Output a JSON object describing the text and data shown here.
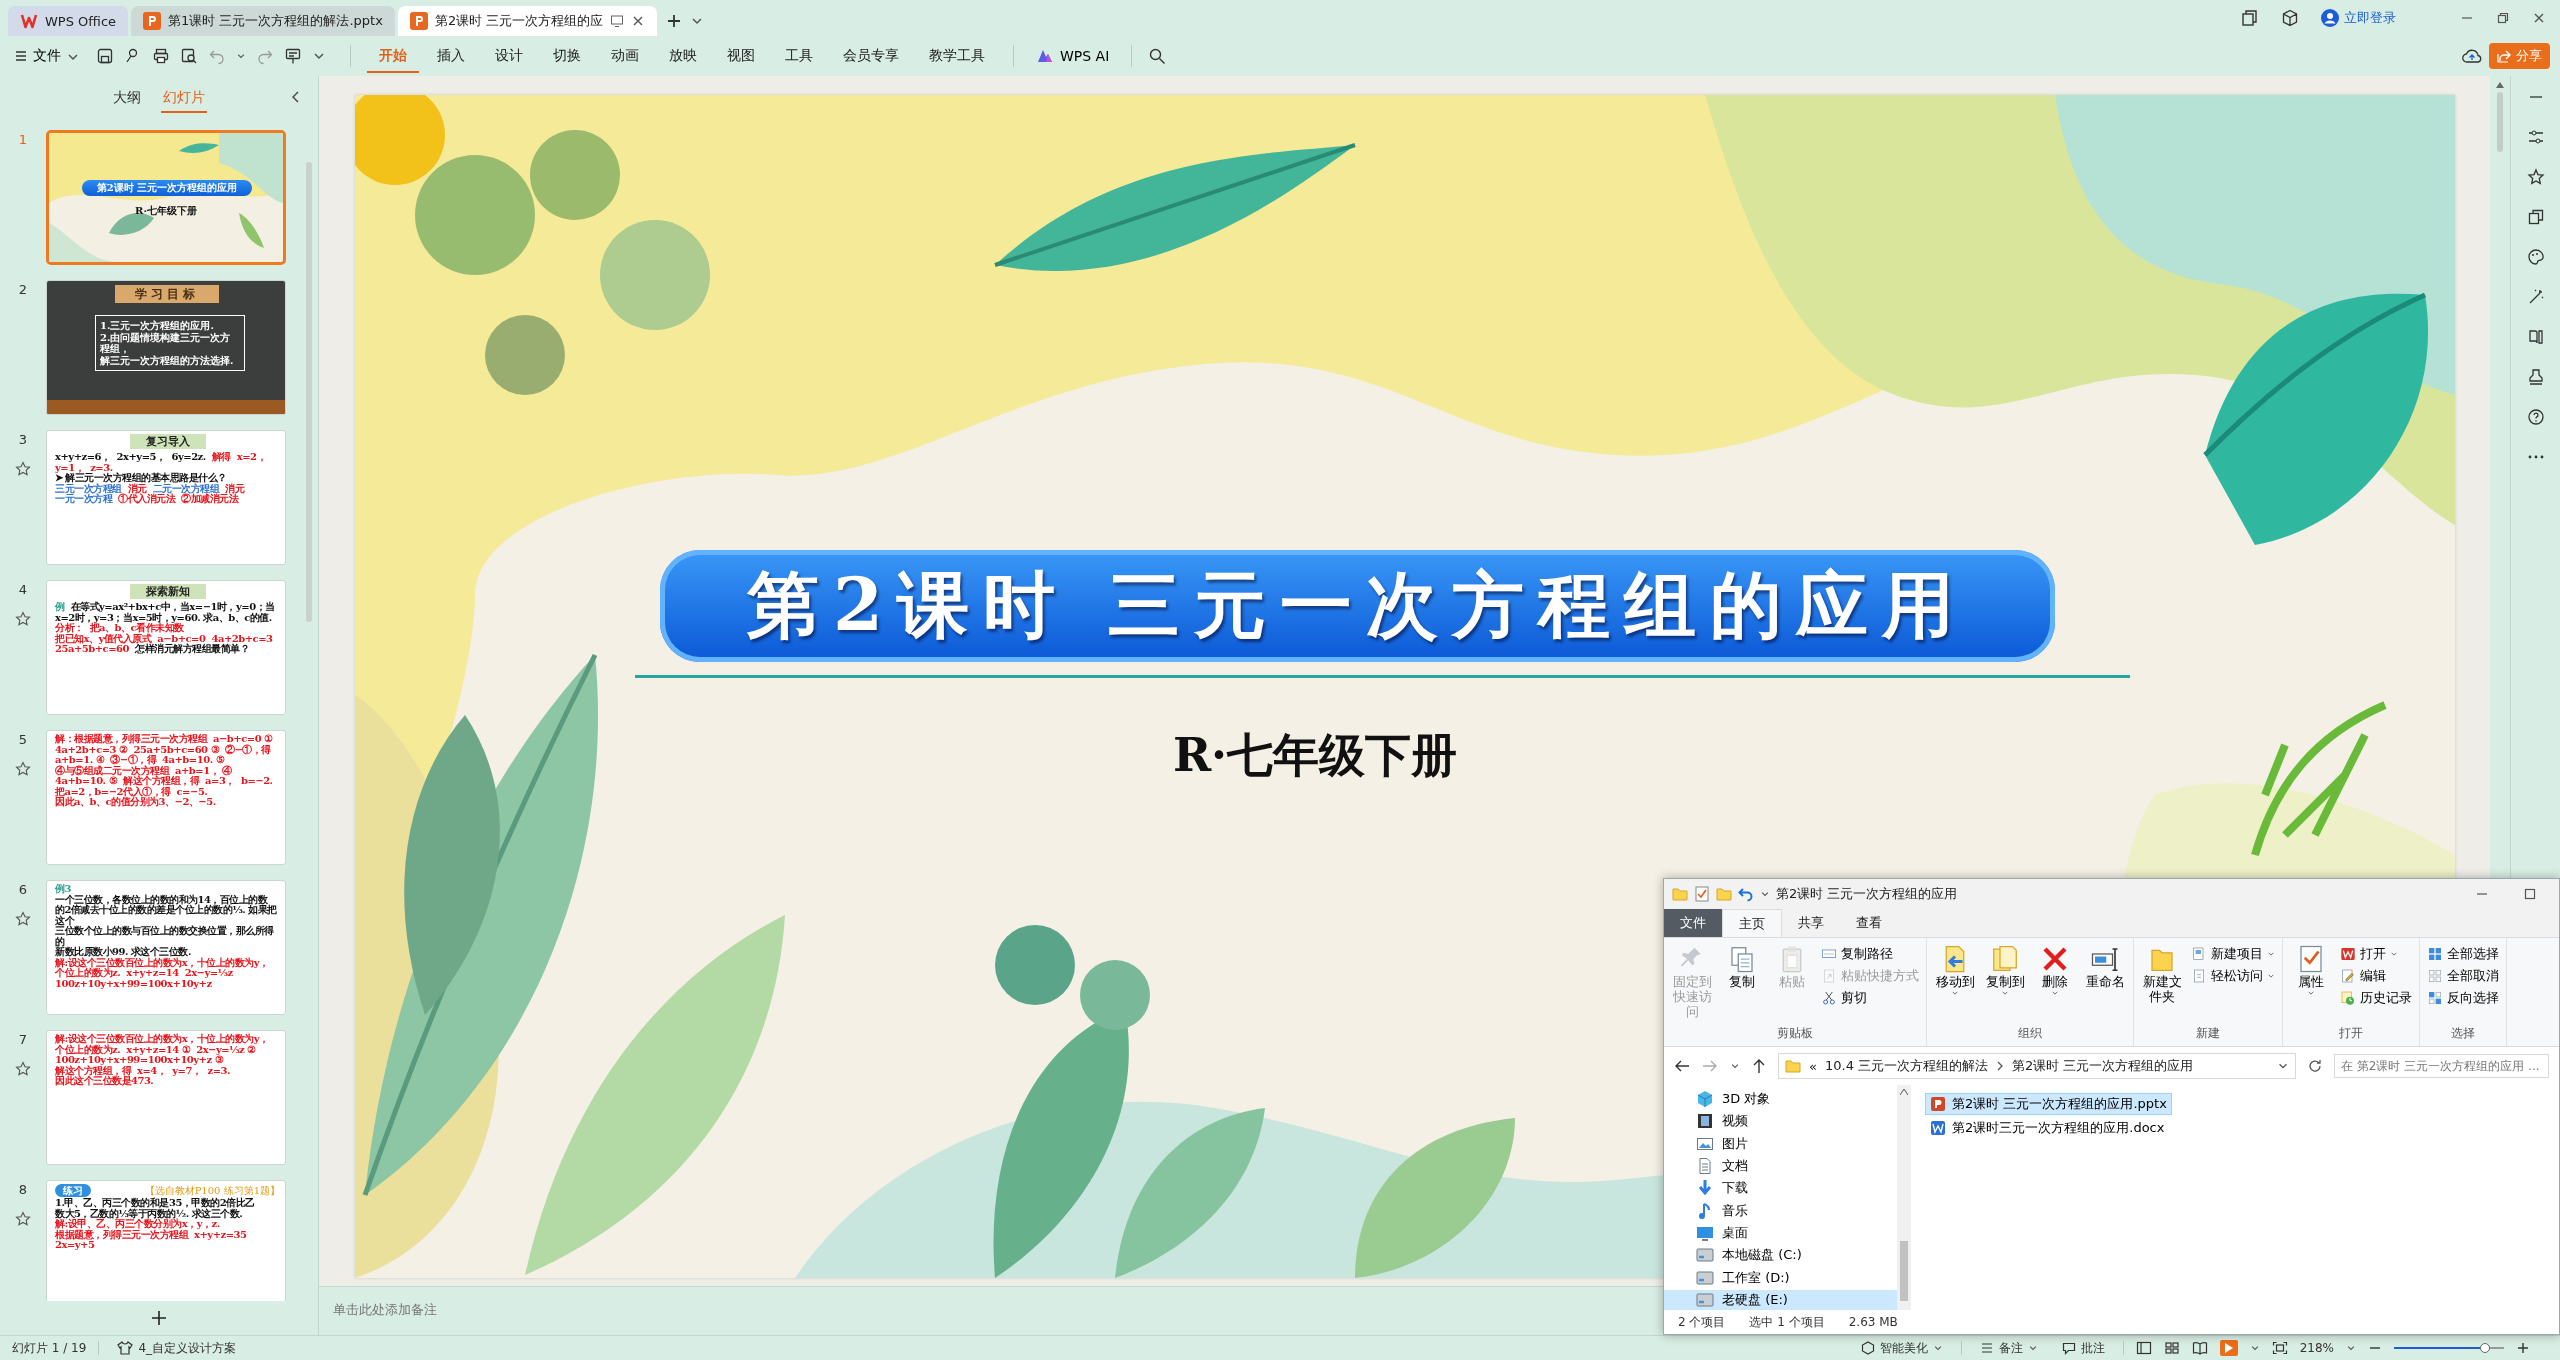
{
  "title_bar": {
    "tabs": [
      {
        "label": "WPS Office",
        "kind": "home",
        "selected": false
      },
      {
        "label": "第1课时 三元一次方程组的解法.pptx",
        "kind": "pptx",
        "selected": false
      },
      {
        "label": "第2课时 三元一次方程组的应",
        "kind": "pptx",
        "selected": true
      }
    ],
    "login": "立即登录"
  },
  "toolbar": {
    "file_menu": "文件",
    "tabs": [
      {
        "label": "开始",
        "selected": true
      },
      {
        "label": "插入",
        "selected": false
      },
      {
        "label": "设计",
        "selected": false
      },
      {
        "label": "切换",
        "selected": false
      },
      {
        "label": "动画",
        "selected": false
      },
      {
        "label": "放映",
        "selected": false
      },
      {
        "label": "视图",
        "selected": false
      },
      {
        "label": "工具",
        "selected": false
      },
      {
        "label": "会员专享",
        "selected": false
      },
      {
        "label": "教学工具",
        "selected": false
      }
    ],
    "ai": "WPS AI",
    "share": "分享"
  },
  "slide_panel": {
    "tabs": [
      {
        "label": "大纲",
        "selected": false
      },
      {
        "label": "幻灯片",
        "selected": true
      }
    ],
    "slides": [
      {
        "number": "1",
        "kind": "title",
        "selected": true,
        "star": false,
        "lines": [
          {
            "text": "第2课时 三元一次方程组的应用",
            "color": "#ffffff"
          },
          {
            "text": "R·七年级下册",
            "color": "#111111"
          }
        ]
      },
      {
        "number": "2",
        "kind": "board",
        "selected": false,
        "star": false,
        "heading": "学习目标",
        "lines": [
          {
            "text": "1.三元一次方程组的应用.",
            "color": "#ffffff"
          },
          {
            "text": "2.由问题情境构建三元一次方程组，",
            "color": "#ffffff"
          },
          {
            "text": "解三元一次方程组的方法选择.",
            "color": "#ffffff"
          }
        ]
      },
      {
        "number": "3",
        "kind": "content",
        "selected": false,
        "star": true,
        "heading": "复习导入",
        "lines": [
          {
            "text": "x+y+z=6，",
            "color": "#111111"
          },
          {
            "text": "2x+y=5，",
            "color": "#111111"
          },
          {
            "text": "6y=2z.",
            "color": "#111111"
          },
          {
            "text": "解得",
            "color": "#e8141b"
          },
          {
            "text": "x=2，",
            "color": "#e8141b"
          },
          {
            "text": "y=1，",
            "color": "#e8141b"
          },
          {
            "text": "z=3.",
            "color": "#e8141b"
          },
          {
            "text": "➤ 解三元一次方程组的基本思路是什么？",
            "color": "#111111"
          },
          {
            "text": "三元一次方程组",
            "color": "#2f74d0"
          },
          {
            "text": "消元",
            "color": "#e8141b"
          },
          {
            "text": "二元一次方程组",
            "color": "#2f74d0"
          },
          {
            "text": "消元",
            "color": "#e8141b"
          },
          {
            "text": "一元一次方程",
            "color": "#2f74d0"
          },
          {
            "text": "①代入消元法",
            "color": "#e8141b"
          },
          {
            "text": "②加减消元法",
            "color": "#e8141b"
          }
        ]
      },
      {
        "number": "4",
        "kind": "content",
        "selected": false,
        "star": true,
        "heading": "探索新知",
        "lines": [
          {
            "text": "例",
            "color": "#2a9d8f"
          },
          {
            "text": "在等式y=ax²+bx+c中，当x=−1时，y=0；当",
            "color": "#111111"
          },
          {
            "text": "x=2时，y=3；当x=5时，y=60. 求a、b、c的值.",
            "color": "#111111"
          },
          {
            "text": "分析：",
            "color": "#e8141b"
          },
          {
            "text": "把a、b、c看作未知数",
            "color": "#e8141b"
          },
          {
            "text": "把已知x、y值代入原式",
            "color": "#e8141b"
          },
          {
            "text": "a−b+c=0",
            "color": "#e8141b"
          },
          {
            "text": "4a+2b+c=3",
            "color": "#e8141b"
          },
          {
            "text": "25a+5b+c=60",
            "color": "#e8141b"
          },
          {
            "text": "怎样消元解方程组最简单？",
            "color": "#111111"
          }
        ]
      },
      {
        "number": "5",
        "kind": "content",
        "selected": false,
        "star": true,
        "lines": [
          {
            "text": "解：根据题意，列得三元一次方程组",
            "color": "#e8141b"
          },
          {
            "text": "a−b+c=0 ①",
            "color": "#e8141b"
          },
          {
            "text": "4a+2b+c=3 ②",
            "color": "#e8141b"
          },
          {
            "text": "25a+5b+c=60 ③",
            "color": "#e8141b"
          },
          {
            "text": "②−①，得",
            "color": "#e8141b"
          },
          {
            "text": "a+b=1. ④",
            "color": "#e8141b"
          },
          {
            "text": "③−①，得",
            "color": "#e8141b"
          },
          {
            "text": "4a+b=10. ⑤",
            "color": "#e8141b"
          },
          {
            "text": "④与⑤组成二元一次方程组",
            "color": "#e8141b"
          },
          {
            "text": "a+b=1， ④",
            "color": "#e8141b"
          },
          {
            "text": "4a+b=10. ⑤",
            "color": "#e8141b"
          },
          {
            "text": "解这个方程组，得",
            "color": "#e8141b"
          },
          {
            "text": "a=3，",
            "color": "#e8141b"
          },
          {
            "text": "b=−2.",
            "color": "#e8141b"
          },
          {
            "text": "把a=2，b=−2代入①，得",
            "color": "#e8141b"
          },
          {
            "text": "c=−5.",
            "color": "#e8141b"
          },
          {
            "text": "因此a、b、c的值分别为3、−2、−5.",
            "color": "#e8141b"
          }
        ]
      },
      {
        "number": "6",
        "kind": "content",
        "selected": false,
        "star": true,
        "lines": [
          {
            "text": "例3",
            "color": "#2a9d8f"
          },
          {
            "text": "一个三位数，各数位上的数的和为14，百位上的数",
            "color": "#111111"
          },
          {
            "text": "的2倍减去十位上的数的差是个位上的数的⅓. 如果把这个",
            "color": "#111111"
          },
          {
            "text": "三位数个位上的数与百位上的数交换位置，那么所得的",
            "color": "#111111"
          },
          {
            "text": "新数比原数小99. 求这个三位数.",
            "color": "#111111"
          },
          {
            "text": "解:设这个三位数百位上的数为x，十位上的数为y，",
            "color": "#e8141b"
          },
          {
            "text": "个位上的数为z.",
            "color": "#e8141b"
          },
          {
            "text": "x+y+z=14",
            "color": "#e8141b"
          },
          {
            "text": "2x−y=⅓z",
            "color": "#e8141b"
          },
          {
            "text": "100z+10y+x+99=100x+10y+z",
            "color": "#e8141b"
          }
        ]
      },
      {
        "number": "7",
        "kind": "content",
        "selected": false,
        "star": true,
        "lines": [
          {
            "text": "解:设这个三位数百位上的数为x，十位上的数为y，",
            "color": "#e8141b"
          },
          {
            "text": "个位上的数为z.",
            "color": "#e8141b"
          },
          {
            "text": "x+y+z=14 ①",
            "color": "#e8141b"
          },
          {
            "text": "2x−y=⅓z ②",
            "color": "#e8141b"
          },
          {
            "text": "100z+10y+x+99=100x+10y+z ③",
            "color": "#e8141b"
          },
          {
            "text": "解这个方程组，得",
            "color": "#e8141b"
          },
          {
            "text": "x=4，",
            "color": "#e8141b"
          },
          {
            "text": "y=7，",
            "color": "#e8141b"
          },
          {
            "text": "z=3.",
            "color": "#e8141b"
          },
          {
            "text": "因此这个三位数是473.",
            "color": "#e8141b"
          }
        ]
      },
      {
        "number": "8",
        "kind": "content",
        "selected": false,
        "star": true,
        "badge": "练习",
        "note": "【选自教材P100 练习第1题】",
        "lines": [
          {
            "text": "1.甲、乙、丙三个数的和是35，甲数的2倍比乙",
            "color": "#111111"
          },
          {
            "text": "数大5，乙数的⅓等于丙数的½. 求这三个数.",
            "color": "#111111"
          },
          {
            "text": "解:设甲、乙、丙三个数分别为x，y，z.",
            "color": "#e8141b"
          },
          {
            "text": "根据题意，列得三元一次方程组",
            "color": "#e8141b"
          },
          {
            "text": "x+y+z=35",
            "color": "#e8141b"
          },
          {
            "text": "2x=y+5",
            "color": "#e8141b"
          }
        ]
      }
    ]
  },
  "slide": {
    "title": "第2课时 三元一次方程组的应用",
    "subtitle": "R·七年级下册"
  },
  "notes": {
    "placeholder": "单击此处添加备注"
  },
  "status_bar": {
    "slide_position": "幻灯片 1 / 19",
    "theme": "4_自定义设计方案",
    "beautify": "智能美化",
    "notes": "备注",
    "comments": "批注",
    "zoom": "218%",
    "zoom_slider": {
      "level": 0.83
    }
  },
  "explorer": {
    "title": "第2课时 三元一次方程组的应用",
    "tabs": [
      {
        "label": "文件",
        "kind": "file",
        "selected": false
      },
      {
        "label": "主页",
        "kind": "tab",
        "selected": true
      },
      {
        "label": "共享",
        "kind": "tab",
        "selected": false
      },
      {
        "label": "查看",
        "kind": "tab",
        "selected": false
      }
    ],
    "groups": [
      {
        "label": "剪贴板",
        "buttons": [
          {
            "label": "固定到快速访问",
            "kind": "large",
            "disabled": true,
            "menu": false
          },
          {
            "label": "复制",
            "kind": "large",
            "disabled": false,
            "menu": false
          },
          {
            "label": "粘贴",
            "kind": "large",
            "disabled": true,
            "menu": false
          },
          {
            "label": "复制路径",
            "kind": "small",
            "disabled": false,
            "menu": false
          },
          {
            "label": "粘贴快捷方式",
            "kind": "small",
            "disabled": true,
            "menu": false
          },
          {
            "label": "剪切",
            "kind": "small",
            "disabled": false,
            "menu": false
          }
        ]
      },
      {
        "label": "组织",
        "buttons": [
          {
            "label": "移动到",
            "kind": "large",
            "disabled": false,
            "menu": true
          },
          {
            "label": "复制到",
            "kind": "large",
            "disabled": false,
            "menu": true
          },
          {
            "label": "删除",
            "kind": "large",
            "disabled": false,
            "menu": true
          },
          {
            "label": "重命名",
            "kind": "large",
            "disabled": false,
            "menu": false
          }
        ]
      },
      {
        "label": "新建",
        "buttons": [
          {
            "label": "新建文件夹",
            "kind": "large",
            "disabled": false,
            "menu": false
          },
          {
            "label": "新建项目",
            "kind": "small",
            "disabled": false,
            "menu": true
          },
          {
            "label": "轻松访问",
            "kind": "small",
            "disabled": false,
            "menu": true
          }
        ]
      },
      {
        "label": "打开",
        "buttons": [
          {
            "label": "属性",
            "kind": "large",
            "disabled": false,
            "menu": true
          },
          {
            "label": "打开",
            "kind": "small",
            "disabled": false,
            "menu": true
          },
          {
            "label": "编辑",
            "kind": "small",
            "disabled": false,
            "menu": false
          },
          {
            "label": "历史记录",
            "kind": "small",
            "disabled": false,
            "menu": false
          }
        ]
      },
      {
        "label": "选择",
        "buttons": [
          {
            "label": "全部选择",
            "kind": "small",
            "disabled": false,
            "menu": false
          },
          {
            "label": "全部取消",
            "kind": "small",
            "disabled": false,
            "menu": false
          },
          {
            "label": "反向选择",
            "kind": "small",
            "disabled": false,
            "menu": false
          }
        ]
      }
    ],
    "address": {
      "overflow": "«",
      "path": [
        "10.4 三元一次方程组的解法",
        "第2课时 三元一次方程组的应用"
      ],
      "search_placeholder": "在 第2课时 三元一次方程组的应用 ..."
    },
    "nav": [
      {
        "label": "3D 对象",
        "selected": false
      },
      {
        "label": "视频",
        "selected": false
      },
      {
        "label": "图片",
        "selected": false
      },
      {
        "label": "文档",
        "selected": false
      },
      {
        "label": "下载",
        "selected": false
      },
      {
        "label": "音乐",
        "selected": false
      },
      {
        "label": "桌面",
        "selected": false
      },
      {
        "label": "本地磁盘 (C:)",
        "selected": false
      },
      {
        "label": "工作室 (D:)",
        "selected": false
      },
      {
        "label": "老硬盘 (E:)",
        "selected": true
      }
    ],
    "files": [
      {
        "name": "第2课时 三元一次方程组的应用.pptx",
        "kind": "pptx",
        "selected": true
      },
      {
        "name": "第2课时三元一次方程组的应用.docx",
        "kind": "docx",
        "selected": false
      }
    ],
    "status": {
      "item_count": "2 个项目",
      "selection": "选中 1 个项目",
      "size": "2.63 MB"
    }
  }
}
